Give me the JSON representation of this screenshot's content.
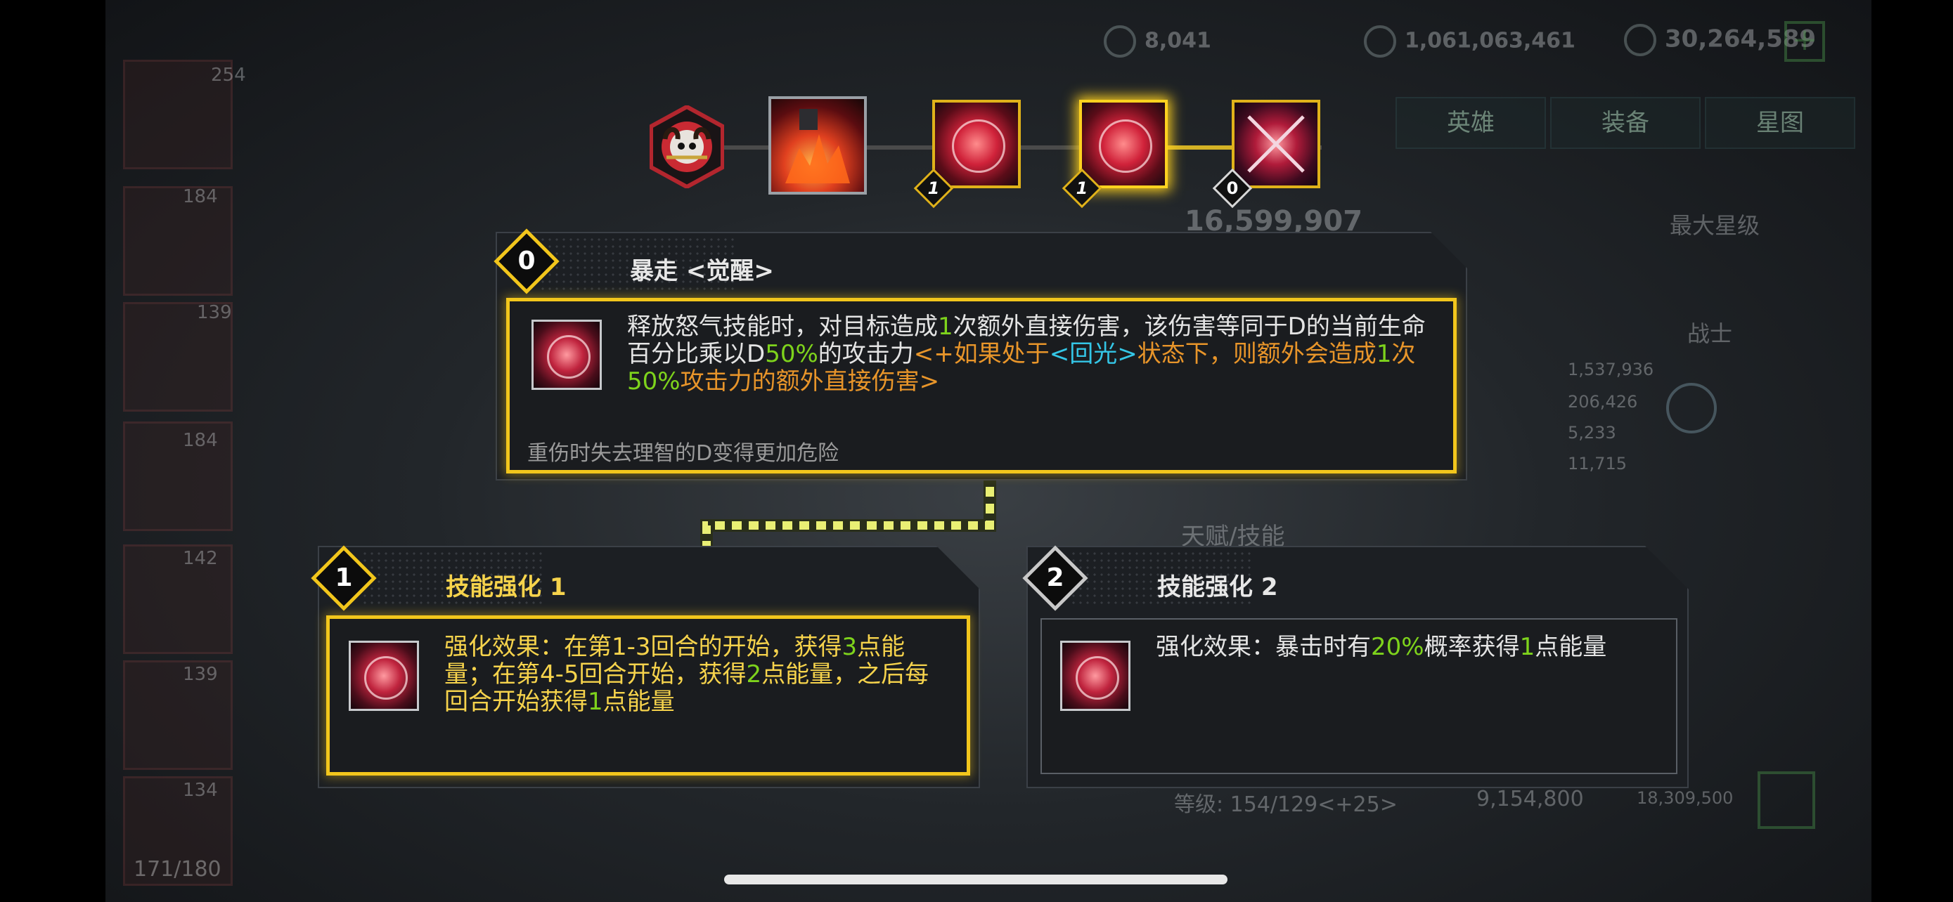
{
  "currencies": [
    {
      "icon": "gear-badge-icon",
      "value": "8,041"
    },
    {
      "icon": "exp-coin-icon",
      "value": "1,061,063,461"
    },
    {
      "icon": "gold-coin-icon",
      "value": "30,264,589"
    }
  ],
  "add_currency_label": "+",
  "background": {
    "tabs": [
      "英雄",
      "装备",
      "星图"
    ],
    "power": "16,599,907",
    "max_star": "最大星级",
    "class_label": "战士",
    "talent_label": "天赋/技能",
    "level_row": "等级: 154/129<+25>",
    "level_cost_1": "9,154,800",
    "level_cost_2": "18,309,500",
    "hero_levels": [
      "254",
      "184",
      "139",
      "184",
      "142",
      "139",
      "134"
    ],
    "stats": [
      "1,537,936",
      "206,426",
      "5,233",
      "11,715"
    ],
    "roster_count": "171/180"
  },
  "skill_chain": {
    "badges": [
      "1",
      "1",
      "0"
    ]
  },
  "awaken_panel": {
    "level": "0",
    "title": "暴走  <觉醒>",
    "desc": {
      "p1": "释放怒气技能时，对目标造成",
      "n1": "1",
      "p2": "次额外直接伤害，该伤害等同于D的当前生命百分比乘以D",
      "n2": "50%",
      "p3": "的攻击力",
      "o1": "<+如果处于",
      "c1": "<回光>",
      "o2": "状态下，则额外会造成",
      "n3": "1",
      "o3": "次",
      "n4": "50%",
      "o4": "攻击力的额外直接伤害>"
    },
    "flavor": "重伤时失去理智的D变得更加危险"
  },
  "enhance_1": {
    "level": "1",
    "title": "技能强化 1",
    "desc": {
      "p1": "强化效果：在第1-3回合的开始，获得",
      "n1": "3",
      "p2": "点能量；在第4-5回合开始，获得",
      "n2": "2",
      "p3": "点能量，之后每回合开始获得",
      "n3": "1",
      "p4": "点能量"
    }
  },
  "enhance_2": {
    "level": "2",
    "title": "技能强化 2",
    "desc": {
      "p1": "强化效果：暴击时有",
      "n1": "20%",
      "p2": "概率获得",
      "n2": "1",
      "p3": "点能量"
    }
  },
  "colors": {
    "gold": "#f2c61c",
    "green": "#7ed31c",
    "orange": "#e8952a",
    "cyan": "#34c6e6"
  }
}
